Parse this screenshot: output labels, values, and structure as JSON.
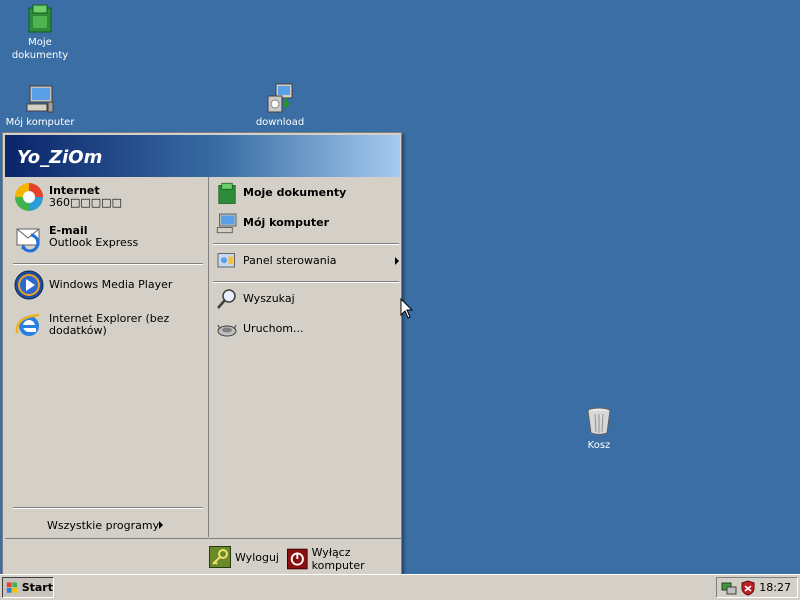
{
  "desktop": {
    "icons": [
      {
        "name": "my-documents",
        "label_line1": "Moje",
        "label_line2": "dokumenty"
      },
      {
        "name": "my-computer",
        "label": "Mój komputer"
      },
      {
        "name": "download",
        "label": "download"
      },
      {
        "name": "recycle-bin",
        "label": "Kosz"
      }
    ]
  },
  "start_menu": {
    "user": "Yo_ZiOm",
    "pinned": [
      {
        "title": "Internet",
        "subtitle": "360□□□□□"
      },
      {
        "title": "E-mail",
        "subtitle": "Outlook Express"
      }
    ],
    "recent": [
      {
        "title": "Windows Media Player"
      },
      {
        "title": "Internet Explorer (bez",
        "title2": "dodatków)"
      }
    ],
    "all_programs": "Wszystkie programy",
    "right": {
      "my_documents": "Moje dokumenty",
      "my_computer": "Mój komputer",
      "control_panel": "Panel sterowania",
      "search": "Wyszukaj",
      "run": "Uruchom..."
    },
    "logoff": "Wyloguj",
    "shutdown": "Wyłącz komputer"
  },
  "taskbar": {
    "start_label": "Start",
    "clock": "18:27"
  }
}
